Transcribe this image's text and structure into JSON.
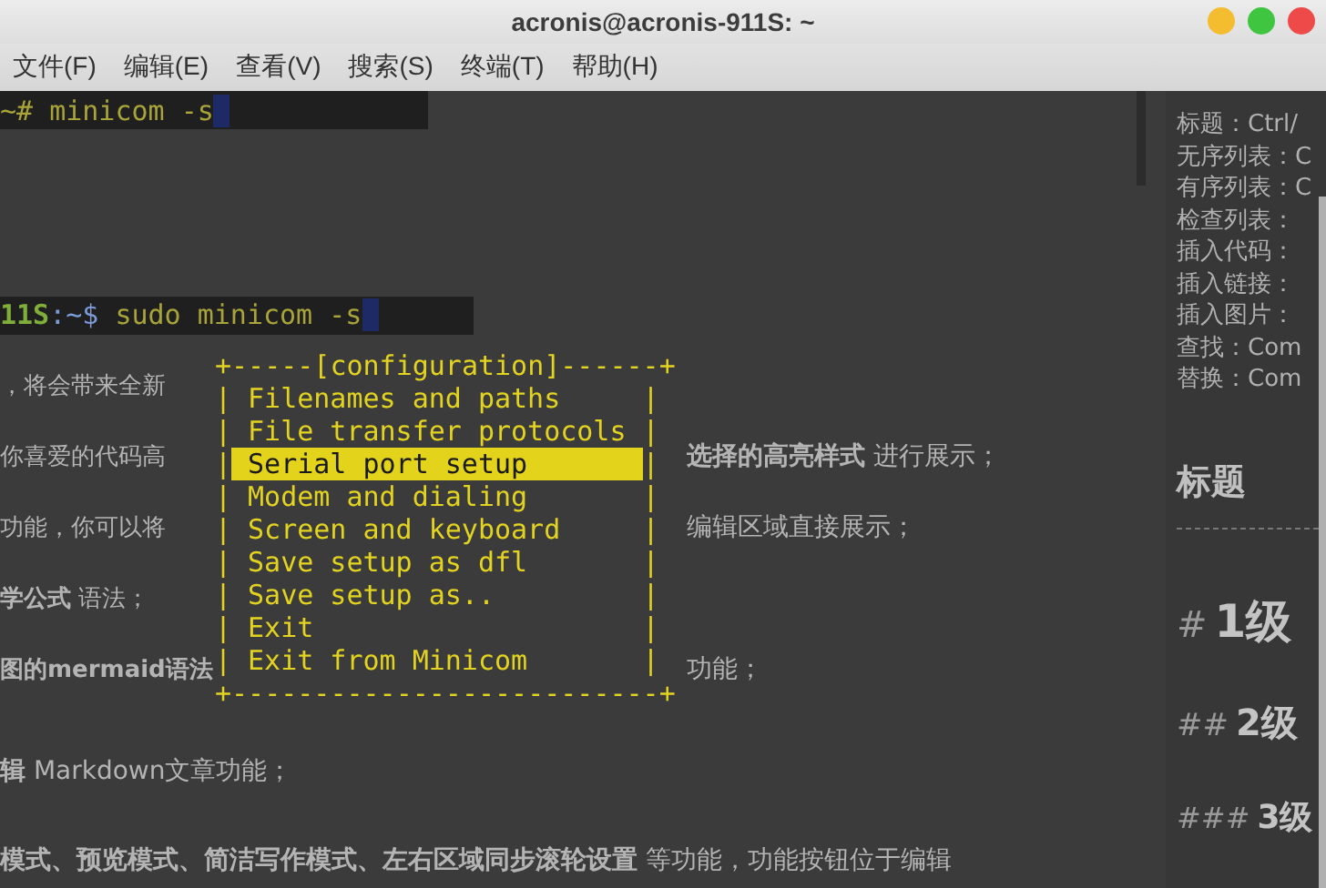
{
  "window": {
    "title": "acronis@acronis-911S: ~"
  },
  "menu_bar": [
    "文件(F)",
    "编辑(E)",
    "查看(V)",
    "搜索(S)",
    "终端(T)",
    "帮助(H)"
  ],
  "terminal": {
    "line_1": {
      "prompt": "~#",
      "command": "minicom -s"
    },
    "line_2": {
      "host": "11S",
      "path": ":~$",
      "command": "sudo minicom -s"
    },
    "config_menu": {
      "top": "+-----[configuration]------+",
      "bottom": "+--------------------------+",
      "side": "|",
      "items": [
        {
          "label": "Filenames and paths",
          "selected": false
        },
        {
          "label": "File transfer protocols",
          "selected": false
        },
        {
          "label": "Serial port setup",
          "selected": true
        },
        {
          "label": "Modem and dialing",
          "selected": false
        },
        {
          "label": "Screen and keyboard",
          "selected": false
        },
        {
          "label": "Save setup as dfl",
          "selected": false
        },
        {
          "label": "Save setup as..",
          "selected": false
        },
        {
          "label": "Exit",
          "selected": false
        },
        {
          "label": "Exit from Minicom",
          "selected": false
        }
      ]
    },
    "background_beside_menu": [
      {
        "left": "，将会带来全新"
      },
      {
        "left": "你喜爱的代码高",
        "right": "**选择的高亮样式** 进行展示；"
      },
      {
        "left": "功能，你可以将",
        "right": "编辑区域直接展示；"
      },
      {
        "left": "**学公式** 语法；"
      },
      {
        "left": "**图的mermaid语法**",
        "right": "功能；"
      }
    ],
    "background_below": [
      "**辑** Markdown文章功能；",
      "**模式、预览模式、简洁写作模式、左右区域同步滚轮设置** 等功能，功能按钮位于编辑"
    ]
  },
  "sidebar": {
    "shortcuts": [
      "标题：Ctrl/",
      "无序列表：C",
      "有序列表：C",
      "检查列表：",
      "插入代码：",
      "插入链接：",
      "插入图片：",
      "查找：Com",
      "替换：Com"
    ],
    "heading": "标题",
    "headings": [
      {
        "marker": "#",
        "text": "1级"
      },
      {
        "marker": "##",
        "text": "2级"
      },
      {
        "marker": "###",
        "text": "3级"
      }
    ]
  }
}
